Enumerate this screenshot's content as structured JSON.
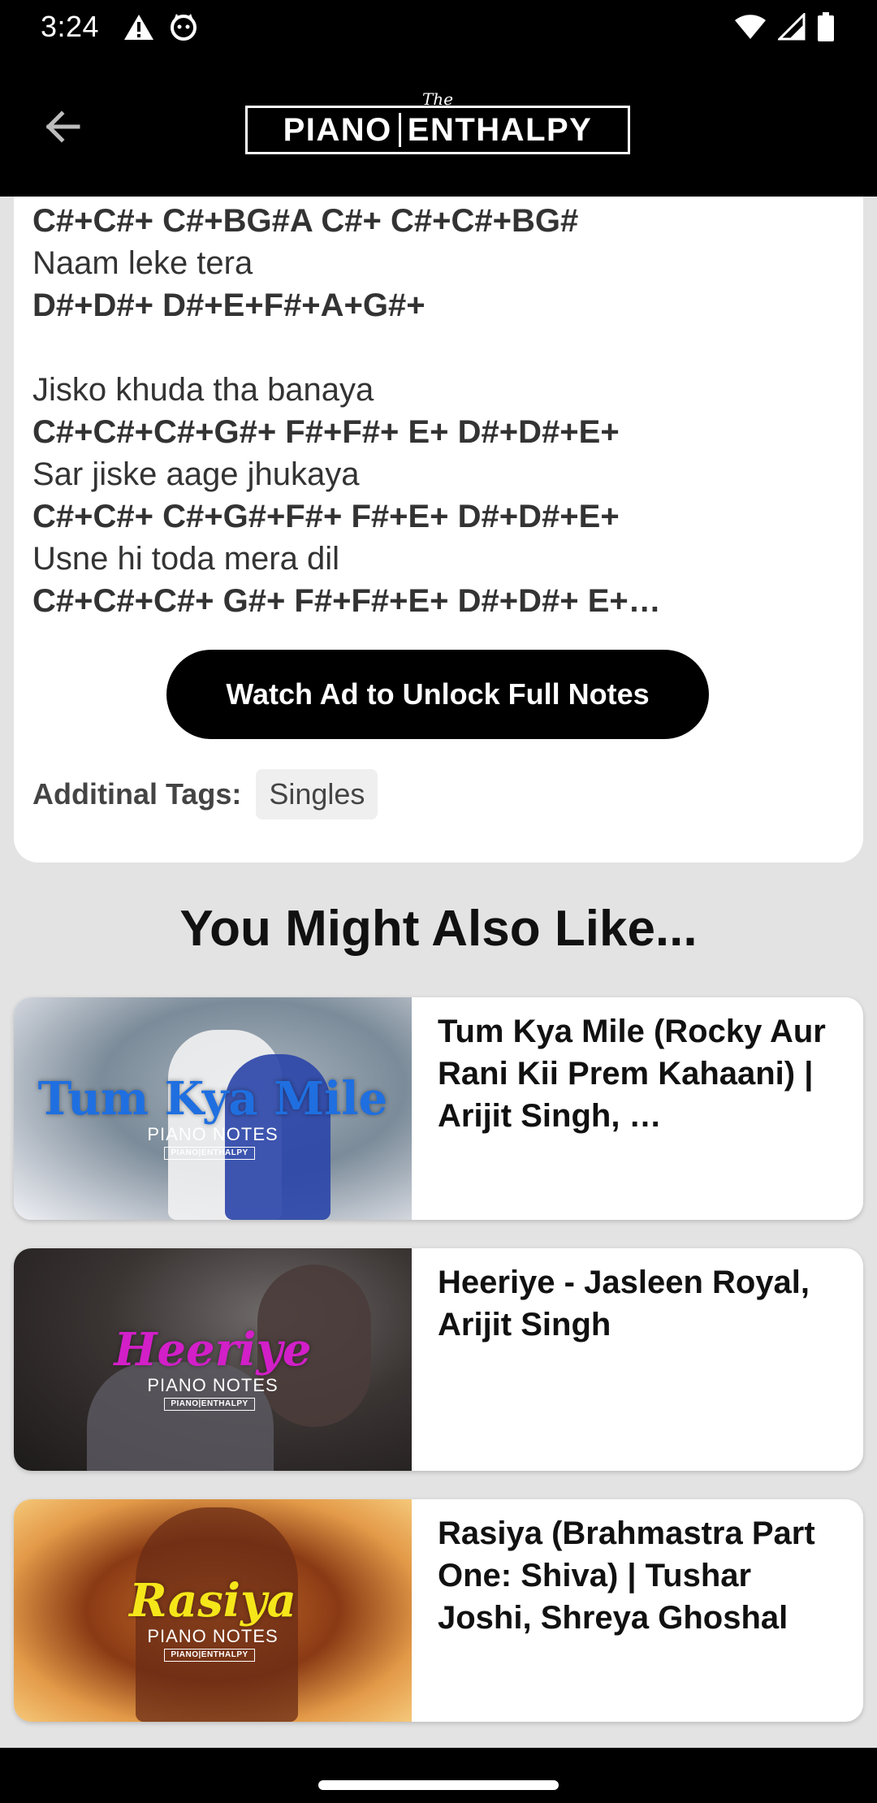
{
  "status_bar": {
    "time": "3:24"
  },
  "app_bar": {
    "logo_the": "The",
    "logo_left": "PIANO",
    "logo_right": "ENTHALPY"
  },
  "notes": {
    "lines": [
      {
        "text": "C#+C#+ C#+BG#A C#+ C#+C#+BG#",
        "bold": true
      },
      {
        "text": "Naam leke tera",
        "bold": false
      },
      {
        "text": "D#+D#+ D#+E+F#+A+G#+",
        "bold": true
      },
      {
        "text": "",
        "bold": false
      },
      {
        "text": "Jisko khuda tha banaya",
        "bold": false
      },
      {
        "text": "C#+C#+C#+G#+ F#+F#+ E+ D#+D#+E+",
        "bold": true
      },
      {
        "text": "Sar jiske aage jhukaya",
        "bold": false
      },
      {
        "text": "C#+C#+ C#+G#+F#+ F#+E+ D#+D#+E+",
        "bold": true
      },
      {
        "text": "Usne hi toda mera dil",
        "bold": false
      },
      {
        "text": "C#+C#+C#+ G#+ F#+F#+E+ D#+D#+ E+…",
        "bold": true
      }
    ],
    "unlock_label": "Watch Ad to Unlock Full Notes",
    "tags_label": "Additinal Tags:",
    "tags": [
      "Singles"
    ]
  },
  "section_title": "You Might Also Like...",
  "songs": [
    {
      "thumb_title": "Tum Kya Mile",
      "thumb_sub": "PIANO NOTES",
      "thumb_logo": "PIANO|ENTHALPY",
      "title": "Tum Kya Mile (Rocky Aur Rani Kii Prem Kahaani) | Arijit Singh, …",
      "thumb_color": "#1f6fe0"
    },
    {
      "thumb_title": "Heeriye",
      "thumb_sub": "PIANO NOTES",
      "thumb_logo": "PIANO|ENTHALPY",
      "title": "Heeriye - Jasleen Royal, Arijit Singh",
      "thumb_color": "#d21fc8"
    },
    {
      "thumb_title": "Rasiya",
      "thumb_sub": "PIANO NOTES",
      "thumb_logo": "PIANO|ENTHALPY",
      "title": "Rasiya (Brahmastra Part One: Shiva) | Tushar Joshi, Shreya Ghoshal",
      "thumb_color": "#f5e61a"
    }
  ]
}
